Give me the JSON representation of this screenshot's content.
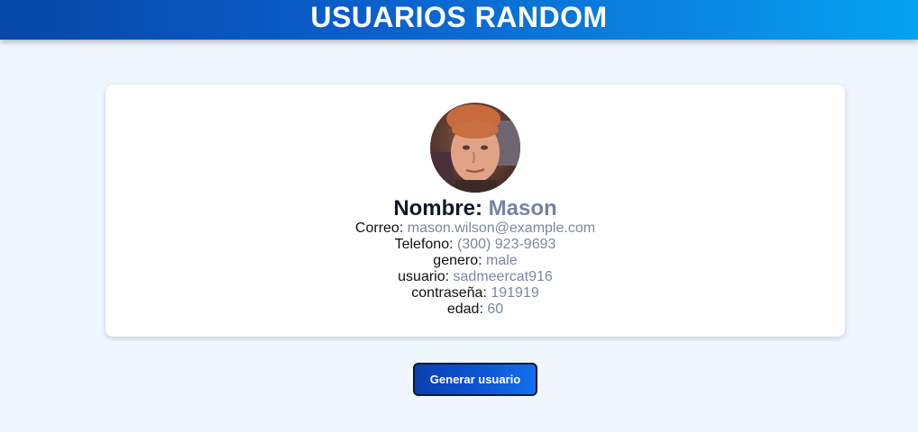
{
  "header": {
    "title": "USUARIOS RANDOM"
  },
  "user": {
    "name_label": "Nombre:",
    "name": "Mason",
    "fields": [
      {
        "label": "Correo:",
        "value": "mason.wilson@example.com"
      },
      {
        "label": "Telefono:",
        "value": "(300) 923-9693"
      },
      {
        "label": "genero:",
        "value": "male"
      },
      {
        "label": "usuario:",
        "value": "sadmeercat916"
      },
      {
        "label": "contraseña:",
        "value": "191919"
      },
      {
        "label": "edad:",
        "value": "60"
      }
    ]
  },
  "actions": {
    "generate_label": "Generar usuario"
  },
  "colors": {
    "header_gradient_start": "#0747a6",
    "header_gradient_end": "#04a3f0",
    "background": "#eff6fe",
    "value_text": "#7b879f",
    "button": "#0d58d8"
  },
  "icons": {
    "avatar": "user-photo"
  }
}
